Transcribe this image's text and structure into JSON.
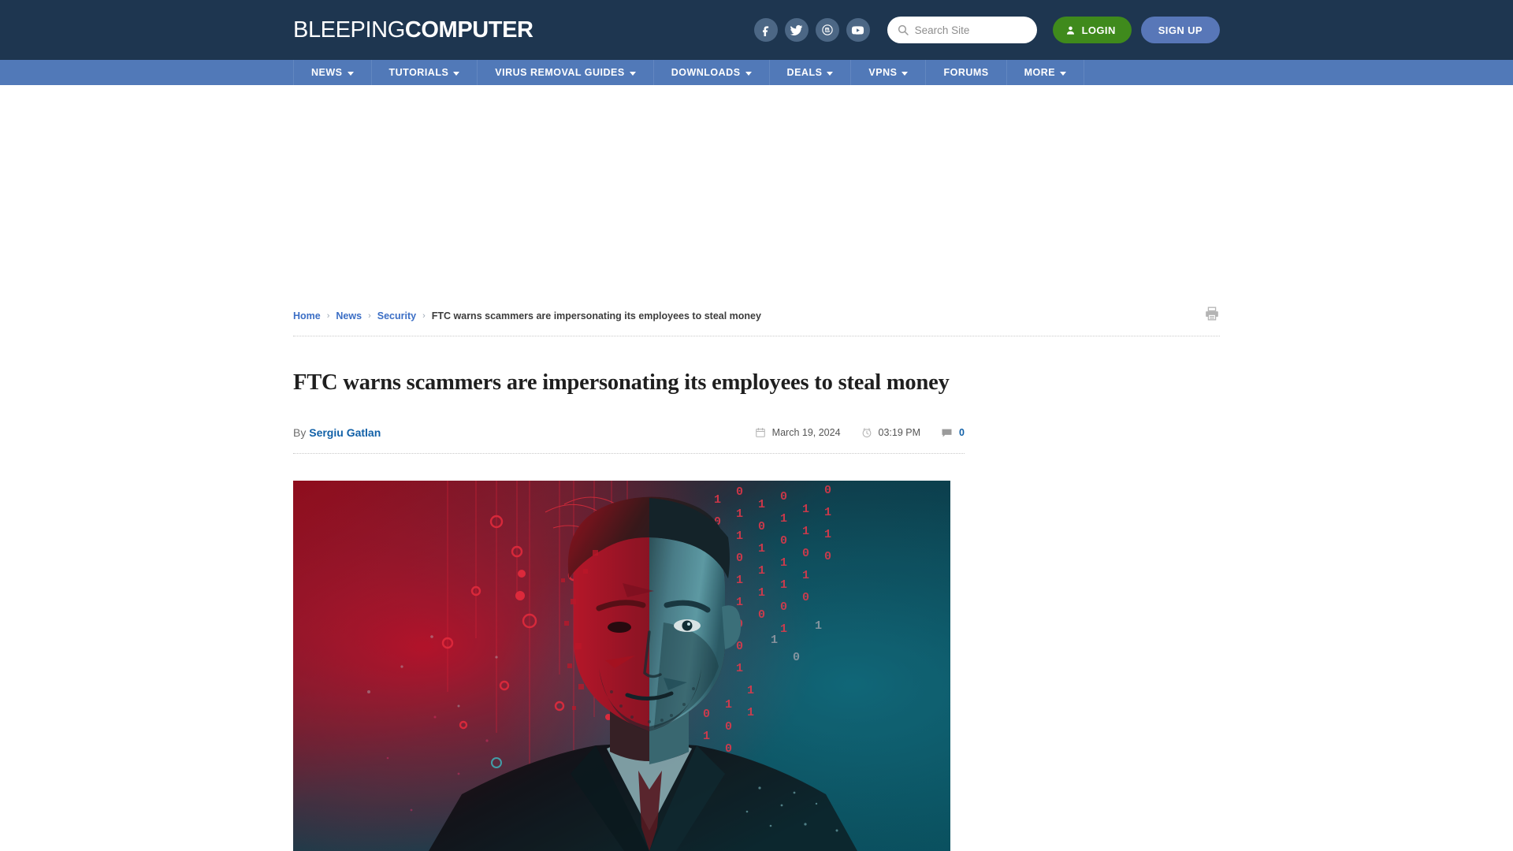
{
  "header": {
    "logo_light": "BLEEPING",
    "logo_bold": "COMPUTER",
    "social": [
      {
        "name": "facebook-icon",
        "label": "Facebook"
      },
      {
        "name": "twitter-icon",
        "label": "Twitter"
      },
      {
        "name": "mastodon-icon",
        "label": "Mastodon"
      },
      {
        "name": "youtube-icon",
        "label": "YouTube"
      }
    ],
    "search": {
      "placeholder": "Search Site",
      "value": "",
      "icon": "search-icon"
    },
    "login_label": "LOGIN",
    "signup_label": "SIGN UP",
    "login_color": "#3f8a1c",
    "signup_color": "#5877b8",
    "background_color": "#1e3650"
  },
  "nav": {
    "background_color": "#5179b8",
    "items": [
      {
        "label": "NEWS",
        "has_dropdown": true
      },
      {
        "label": "TUTORIALS",
        "has_dropdown": true
      },
      {
        "label": "VIRUS REMOVAL GUIDES",
        "has_dropdown": true
      },
      {
        "label": "DOWNLOADS",
        "has_dropdown": true
      },
      {
        "label": "DEALS",
        "has_dropdown": true
      },
      {
        "label": "VPNS",
        "has_dropdown": true
      },
      {
        "label": "FORUMS",
        "has_dropdown": false
      },
      {
        "label": "MORE",
        "has_dropdown": true
      }
    ]
  },
  "breadcrumb": {
    "items": [
      {
        "label": "Home",
        "is_link": true
      },
      {
        "label": "News",
        "is_link": true
      },
      {
        "label": "Security",
        "is_link": true
      },
      {
        "label": "FTC warns scammers are impersonating its employees to steal money",
        "is_link": false
      }
    ],
    "separator": "›",
    "print_icon": "printer-icon"
  },
  "article": {
    "title": "FTC warns scammers are impersonating its employees to steal money",
    "byline_prefix": "By",
    "author": "Sergiu Gatlan",
    "date": "March 19, 2024",
    "time": "03:19 PM",
    "comment_count": "0",
    "date_icon": "calendar-icon",
    "time_icon": "clock-icon",
    "comment_icon": "comment-icon",
    "hero_image_alt": "Man in a suit split by red and teal lighting with falling binary digits"
  }
}
